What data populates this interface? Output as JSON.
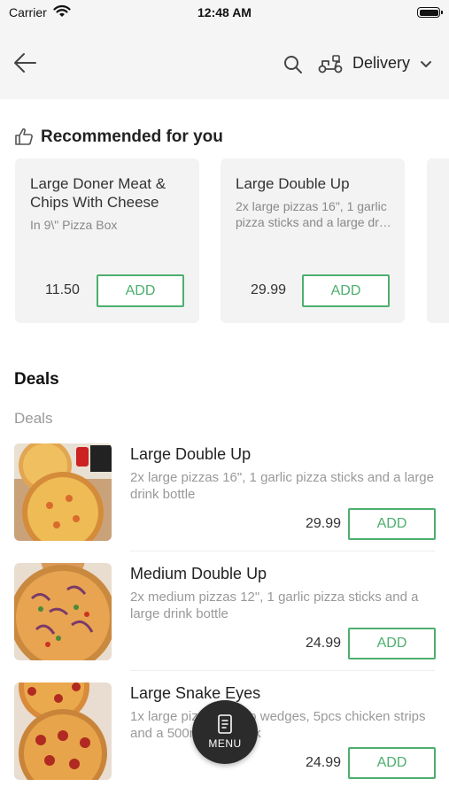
{
  "status_bar": {
    "carrier": "Carrier",
    "time": "12:48 AM"
  },
  "header": {
    "delivery_label": "Delivery"
  },
  "recommended": {
    "title": "Recommended for you",
    "cards": [
      {
        "name": "Large Doner Meat & Chips With Cheese",
        "description": "In 9\\\" Pizza Box",
        "price": "11.50",
        "add_label": "ADD"
      },
      {
        "name": "Large Double Up",
        "description": "2x large pizzas 16\", 1 garlic pizza sticks and a large dr…",
        "price": "29.99",
        "add_label": "ADD"
      }
    ]
  },
  "deals": {
    "heading": "Deals",
    "subheading": "Deals",
    "items": [
      {
        "name": "Large Double Up",
        "description": "2x large pizzas 16\", 1 garlic pizza sticks and a large drink bottle",
        "price": "29.99",
        "add_label": "ADD"
      },
      {
        "name": "Medium Double Up",
        "description": "2x medium pizzas 12\", 1 garlic pizza sticks and a large drink bottle",
        "price": "24.99",
        "add_label": "ADD"
      },
      {
        "name": "Large Snake Eyes",
        "description": "1x large pizza, potato wedges, 5pcs chicken strips and a 500ml soft drink",
        "price": "24.99",
        "add_label": "ADD"
      }
    ]
  },
  "menu_fab": {
    "label": "MENU"
  },
  "colors": {
    "accent": "#4caf6e",
    "card_bg": "#f3f3f3",
    "header_bg": "#f5f5f5",
    "fab_bg": "#2b2b2b"
  }
}
